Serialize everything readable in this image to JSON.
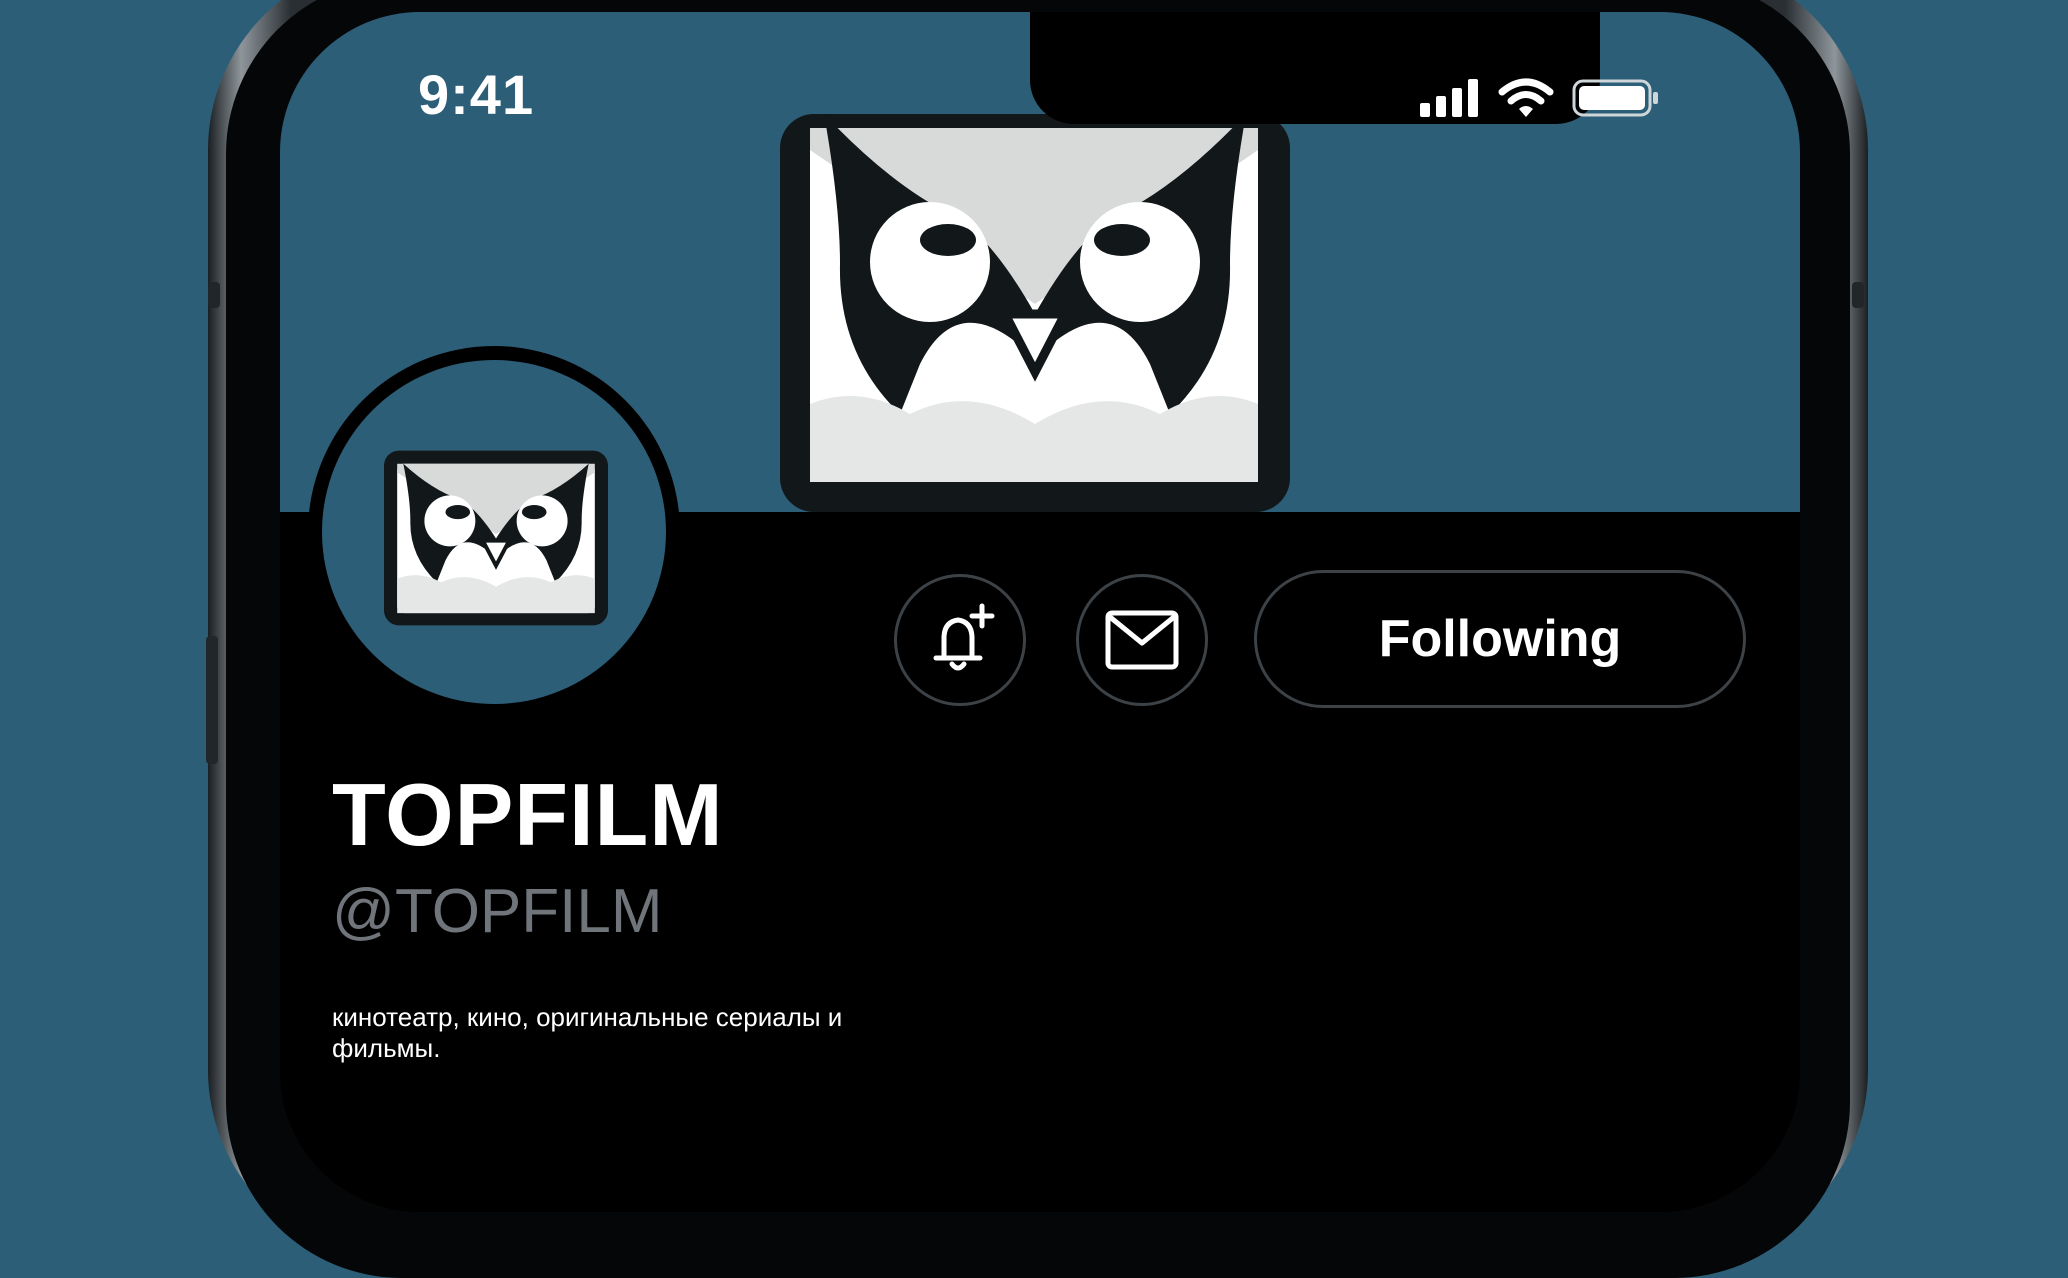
{
  "status_bar": {
    "time": "9:41"
  },
  "profile": {
    "name": "TOPFILM",
    "handle": "@TOPFILM",
    "bio": "кинотеатр, кино, оригинальные сериалы и фильмы."
  },
  "actions": {
    "notify_icon": "bell-plus-icon",
    "message_icon": "envelope-icon",
    "follow_label": "Following"
  },
  "colors": {
    "background": "#2d5e78",
    "screen": "#000000",
    "text": "#ffffff",
    "handle": "#6f757a"
  }
}
